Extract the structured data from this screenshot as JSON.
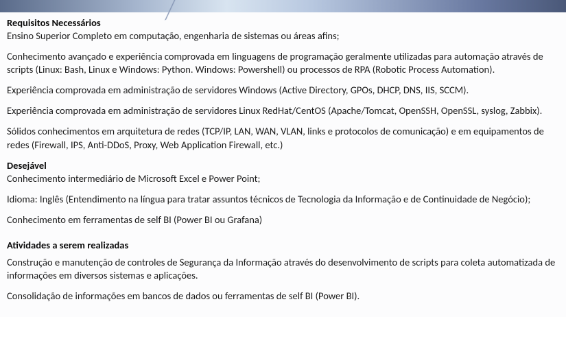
{
  "sections": {
    "required": {
      "heading": "Requisitos Necessários",
      "items": [
        "Ensino Superior Completo em computação, engenharia de sistemas ou áreas afins;",
        "Conhecimento avançado e experiência comprovada em linguagens de programação geralmente utilizadas para automação através de scripts (Linux: Bash, Linux e Windows: Python. Windows: Powershell) ou processos de RPA (Robotic Process Automation).",
        "Experiência comprovada em administração de servidores Windows (Active Directory, GPOs, DHCP, DNS, IIS, SCCM).",
        "Experiência comprovada em administração de servidores Linux RedHat/CentOS (Apache/Tomcat, OpenSSH, OpenSSL, syslog, Zabbix).",
        "Sólidos conhecimentos em arquitetura de redes (TCP/IP, LAN, WAN, VLAN, links e protocolos de comunicação) e em equipamentos de redes (Firewall, IPS, Anti-DDoS, Proxy, Web Application Firewall, etc.)"
      ]
    },
    "desirable": {
      "heading": "Desejável",
      "items": [
        "Conhecimento intermediário de Microsoft Excel e Power Point;",
        "Idioma: Inglês (Entendimento na língua para tratar assuntos técnicos de Tecnologia da Informação e de Continuidade de Negócio);",
        "Conhecimento em ferramentas de self BI (Power BI ou Grafana)"
      ]
    },
    "activities": {
      "heading": "Atividades a serem realizadas",
      "items": [
        "Construção e manutenção de controles de Segurança da Informação através do desenvolvimento de scripts para coleta automatizada de informações em diversos sistemas e aplicações.",
        "Consolidação de informações em bancos de dados ou ferramentas de self BI (Power BI)."
      ]
    }
  }
}
